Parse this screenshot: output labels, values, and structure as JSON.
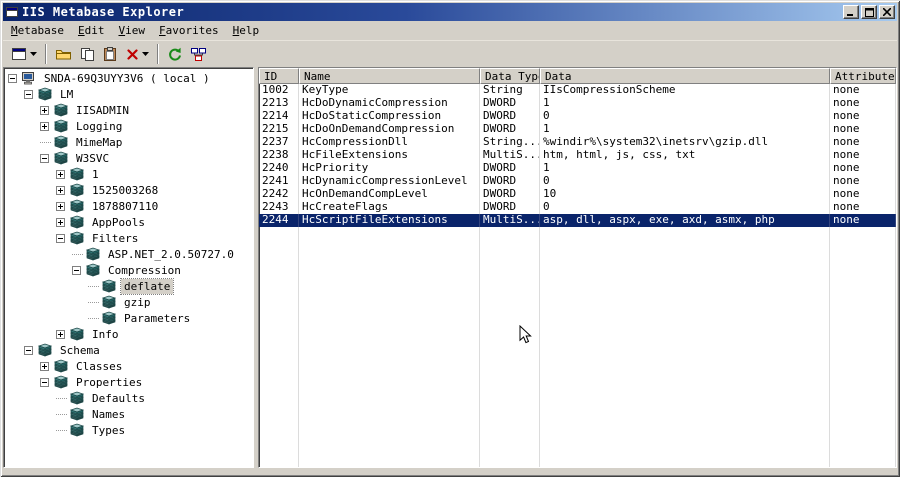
{
  "window": {
    "title": "IIS Metabase Explorer"
  },
  "menubar": {
    "items": [
      {
        "label": "Metabase",
        "mnemonic": 0
      },
      {
        "label": "Edit",
        "mnemonic": 0
      },
      {
        "label": "View",
        "mnemonic": 0
      },
      {
        "label": "Favorites",
        "mnemonic": 0
      },
      {
        "label": "Help",
        "mnemonic": 0
      }
    ]
  },
  "toolbar": {
    "buttons": [
      {
        "name": "view",
        "icon": "window",
        "dropdown": true
      },
      {
        "type": "separator"
      },
      {
        "name": "open",
        "icon": "folder-open",
        "dropdown": false
      },
      {
        "name": "copy",
        "icon": "copy"
      },
      {
        "name": "paste",
        "icon": "paste"
      },
      {
        "name": "delete",
        "icon": "delete",
        "dropdown": true
      },
      {
        "type": "separator"
      },
      {
        "name": "refresh",
        "icon": "refresh"
      },
      {
        "name": "connect",
        "icon": "network"
      }
    ]
  },
  "tree": {
    "items": [
      {
        "level": 0,
        "label": "SNDA-69Q3UYY3V6 ( local )",
        "expander": "minus",
        "icon": "computer"
      },
      {
        "level": 1,
        "label": "LM",
        "expander": "minus",
        "icon": "node"
      },
      {
        "level": 2,
        "label": "IISADMIN",
        "expander": "plus",
        "icon": "node"
      },
      {
        "level": 2,
        "label": "Logging",
        "expander": "plus",
        "icon": "node"
      },
      {
        "level": 2,
        "label": "MimeMap",
        "expander": "none",
        "icon": "node"
      },
      {
        "level": 2,
        "label": "W3SVC",
        "expander": "minus",
        "icon": "node"
      },
      {
        "level": 3,
        "label": "1",
        "expander": "plus",
        "icon": "node"
      },
      {
        "level": 3,
        "label": "1525003268",
        "expander": "plus",
        "icon": "node"
      },
      {
        "level": 3,
        "label": "1878807110",
        "expander": "plus",
        "icon": "node"
      },
      {
        "level": 3,
        "label": "AppPools",
        "expander": "plus",
        "icon": "node"
      },
      {
        "level": 3,
        "label": "Filters",
        "expander": "minus",
        "icon": "node"
      },
      {
        "level": 4,
        "label": "ASP.NET_2.0.50727.0",
        "expander": "none",
        "icon": "node"
      },
      {
        "level": 4,
        "label": "Compression",
        "expander": "minus",
        "icon": "node"
      },
      {
        "level": 5,
        "label": "deflate",
        "expander": "none",
        "icon": "node",
        "selected": true
      },
      {
        "level": 5,
        "label": "gzip",
        "expander": "none",
        "icon": "node"
      },
      {
        "level": 5,
        "label": "Parameters",
        "expander": "none",
        "icon": "node"
      },
      {
        "level": 3,
        "label": "Info",
        "expander": "plus",
        "icon": "node"
      },
      {
        "level": 1,
        "label": "Schema",
        "expander": "minus",
        "icon": "node"
      },
      {
        "level": 2,
        "label": "Classes",
        "expander": "plus",
        "icon": "node"
      },
      {
        "level": 2,
        "label": "Properties",
        "expander": "minus",
        "icon": "node"
      },
      {
        "level": 3,
        "label": "Defaults",
        "expander": "none",
        "icon": "node"
      },
      {
        "level": 3,
        "label": "Names",
        "expander": "none",
        "icon": "node"
      },
      {
        "level": 3,
        "label": "Types",
        "expander": "none",
        "icon": "node"
      }
    ]
  },
  "table": {
    "columns": [
      "ID",
      "Name",
      "Data Type",
      "Data",
      "Attributes"
    ],
    "rows": [
      {
        "id": "1002",
        "name": "KeyType",
        "type": "String",
        "data": "IIsCompressionScheme",
        "attrs": "none"
      },
      {
        "id": "2213",
        "name": "HcDoDynamicCompression",
        "type": "DWORD",
        "data": "1",
        "attrs": "none"
      },
      {
        "id": "2214",
        "name": "HcDoStaticCompression",
        "type": "DWORD",
        "data": "0",
        "attrs": "none"
      },
      {
        "id": "2215",
        "name": "HcDoOnDemandCompression",
        "type": "DWORD",
        "data": "1",
        "attrs": "none"
      },
      {
        "id": "2237",
        "name": "HcCompressionDll",
        "type": "String...",
        "data": "%windir%\\system32\\inetsrv\\gzip.dll",
        "attrs": "none"
      },
      {
        "id": "2238",
        "name": "HcFileExtensions",
        "type": "MultiS...",
        "data": "htm, html, js, css, txt",
        "attrs": "none"
      },
      {
        "id": "2240",
        "name": "HcPriority",
        "type": "DWORD",
        "data": "1",
        "attrs": "none"
      },
      {
        "id": "2241",
        "name": "HcDynamicCompressionLevel",
        "type": "DWORD",
        "data": "0",
        "attrs": "none"
      },
      {
        "id": "2242",
        "name": "HcOnDemandCompLevel",
        "type": "DWORD",
        "data": "10",
        "attrs": "none"
      },
      {
        "id": "2243",
        "name": "HcCreateFlags",
        "type": "DWORD",
        "data": "0",
        "attrs": "none"
      },
      {
        "id": "2244",
        "name": "HcScriptFileExtensions",
        "type": "MultiS...",
        "data": "asp, dll, aspx, exe, axd, asmx, php",
        "attrs": "none",
        "selected": true
      }
    ]
  }
}
